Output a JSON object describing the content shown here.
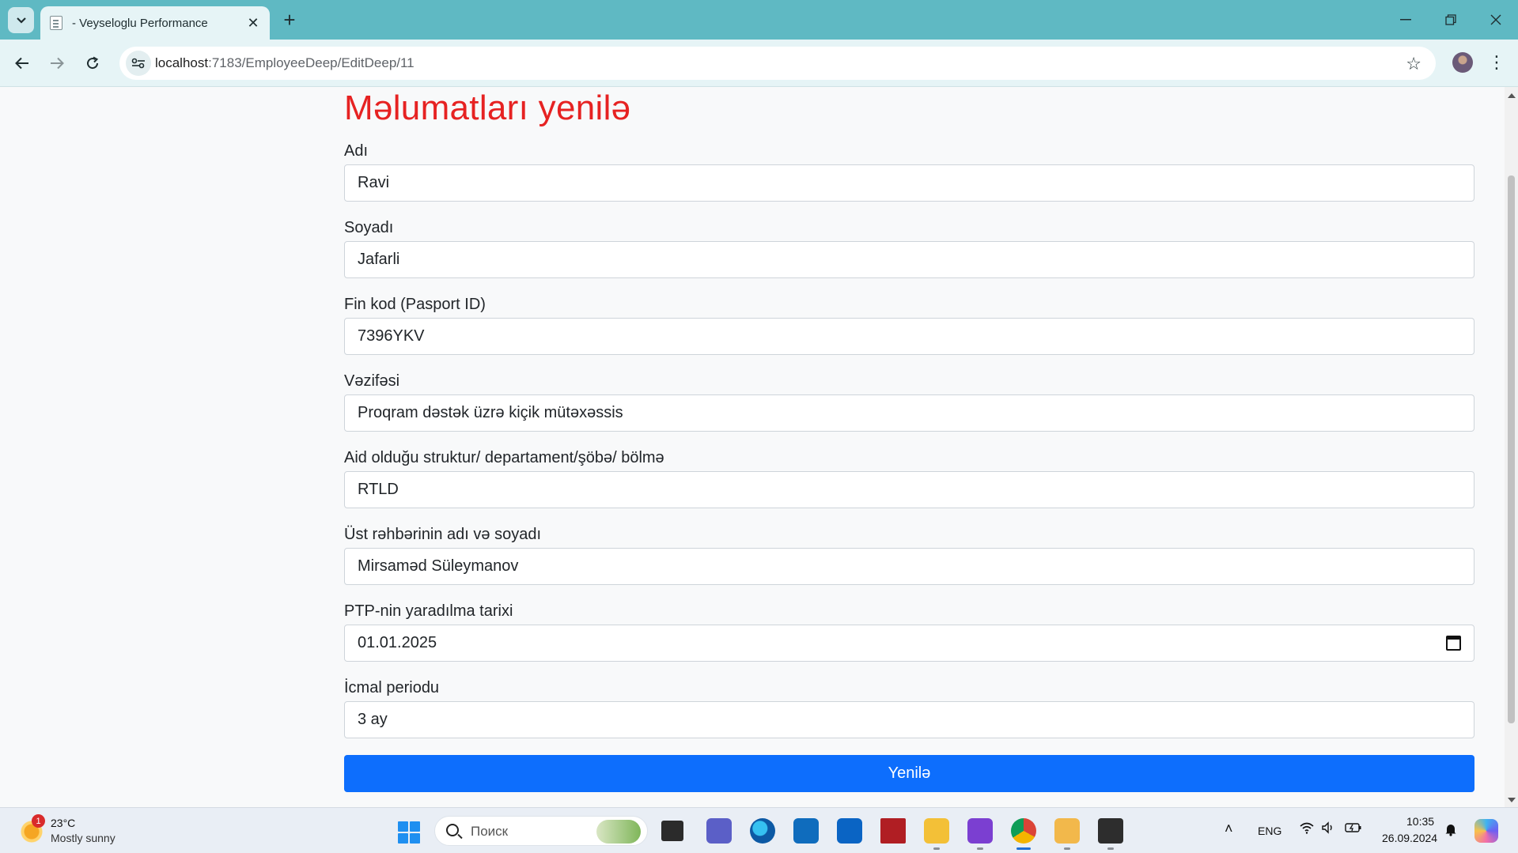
{
  "browser": {
    "tab_title": "- Veyseloglu Performance",
    "url_host": "localhost",
    "url_path": ":7183/EmployeeDeep/EditDeep/11"
  },
  "form": {
    "title": "Məlumatları yenilə",
    "fields": [
      {
        "label": "Adı",
        "value": "Ravi"
      },
      {
        "label": "Soyadı",
        "value": "Jafarli"
      },
      {
        "label": "Fin kod (Pasport ID)",
        "value": "7396YKV"
      },
      {
        "label": "Vəzifəsi",
        "value": "Proqram dəstək üzrə kiçik mütəxəssis"
      },
      {
        "label": "Aid olduğu struktur/ departament/şöbə/ bölmə",
        "value": "RTLD"
      },
      {
        "label": "Üst rəhbərinin adı və soyadı",
        "value": "Mirsaməd Süleymanov"
      },
      {
        "label": "PTP-nin yaradılma tarixi",
        "value": "01.01.2025"
      },
      {
        "label": "İcmal periodu",
        "value": "3 ay"
      }
    ],
    "submit_label": "Yenilə"
  },
  "taskbar": {
    "weather_temp": "23°C",
    "weather_desc": "Mostly sunny",
    "weather_badge": "1",
    "search_placeholder": "Поиск",
    "language": "ENG",
    "time": "10:35",
    "date": "26.09.2024"
  },
  "colors": {
    "title": "#e62222",
    "primary_button": "#0d6efd",
    "tabbar": "#5fb9c3"
  }
}
